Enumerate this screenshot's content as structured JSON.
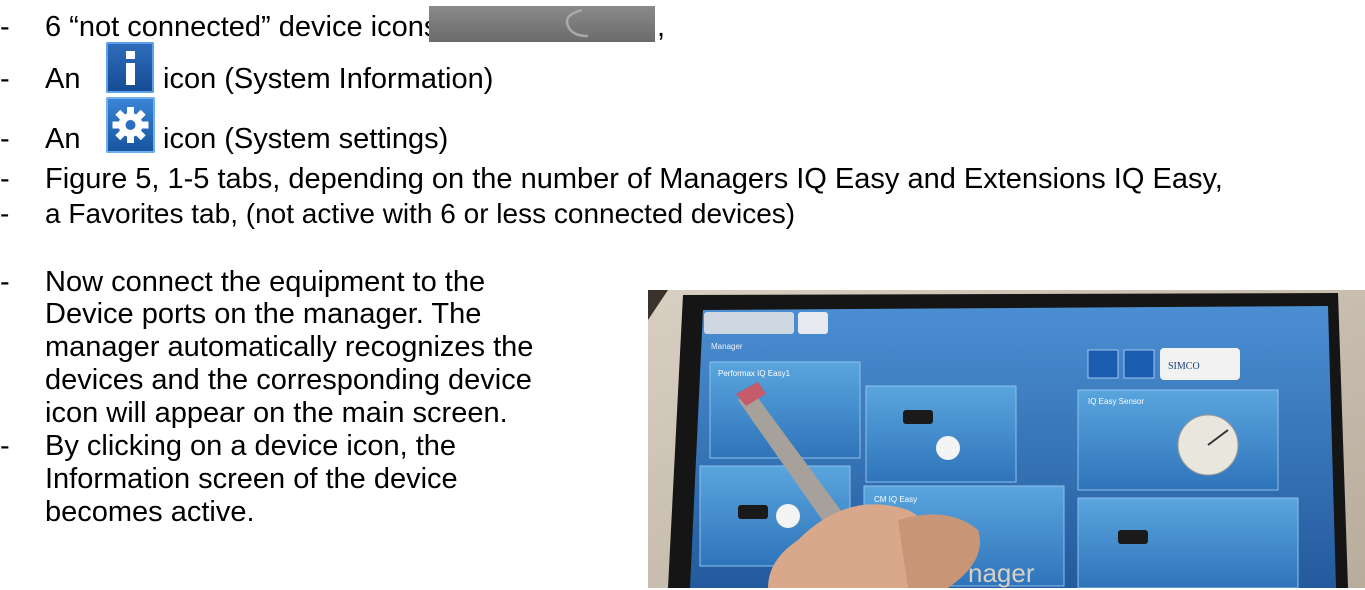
{
  "lines": [
    {
      "dash": "-",
      "before": "6 “not connected” device icons",
      "after": ","
    },
    {
      "dash": "-",
      "before": "An",
      "after": "icon (System Information)"
    },
    {
      "dash": "-",
      "before": "An",
      "after": "icon (System settings)"
    },
    {
      "dash": "-",
      "text": "Figure 5, 1-5 tabs, depending on the number of Managers IQ Easy and Extensions IQ Easy,"
    },
    {
      "dash": "-",
      "text": "a Favorites tab, (not active with 6 or less connected devices)"
    }
  ],
  "bullets2": [
    {
      "dash": "-",
      "lines": [
        "Now connect the equipment to the",
        "Device ports on the manager. The",
        "manager automatically recognizes the",
        "devices and the corresponding device",
        "icon will appear on the main screen."
      ]
    },
    {
      "dash": "-",
      "lines": [
        "By clicking on a device icon, the",
        "Information screen of the device",
        "becomes active."
      ]
    }
  ],
  "photo": {
    "screen_header": "Manager",
    "tile_labels": [
      "Performax IQ Easy1",
      "IQ Easy Sensor",
      "CM IQ Easy"
    ],
    "logo_text": "SIMCO",
    "bottom_text": "nager"
  },
  "colors": {
    "text": "#000000",
    "icon_blue": "#1a5cb0",
    "notconn_gray": "#7a7a7a",
    "screen_blue": "#3a7fc6"
  },
  "icons": {
    "notconnected": "plug-icon",
    "info": "info-icon",
    "settings": "gear-icon"
  }
}
